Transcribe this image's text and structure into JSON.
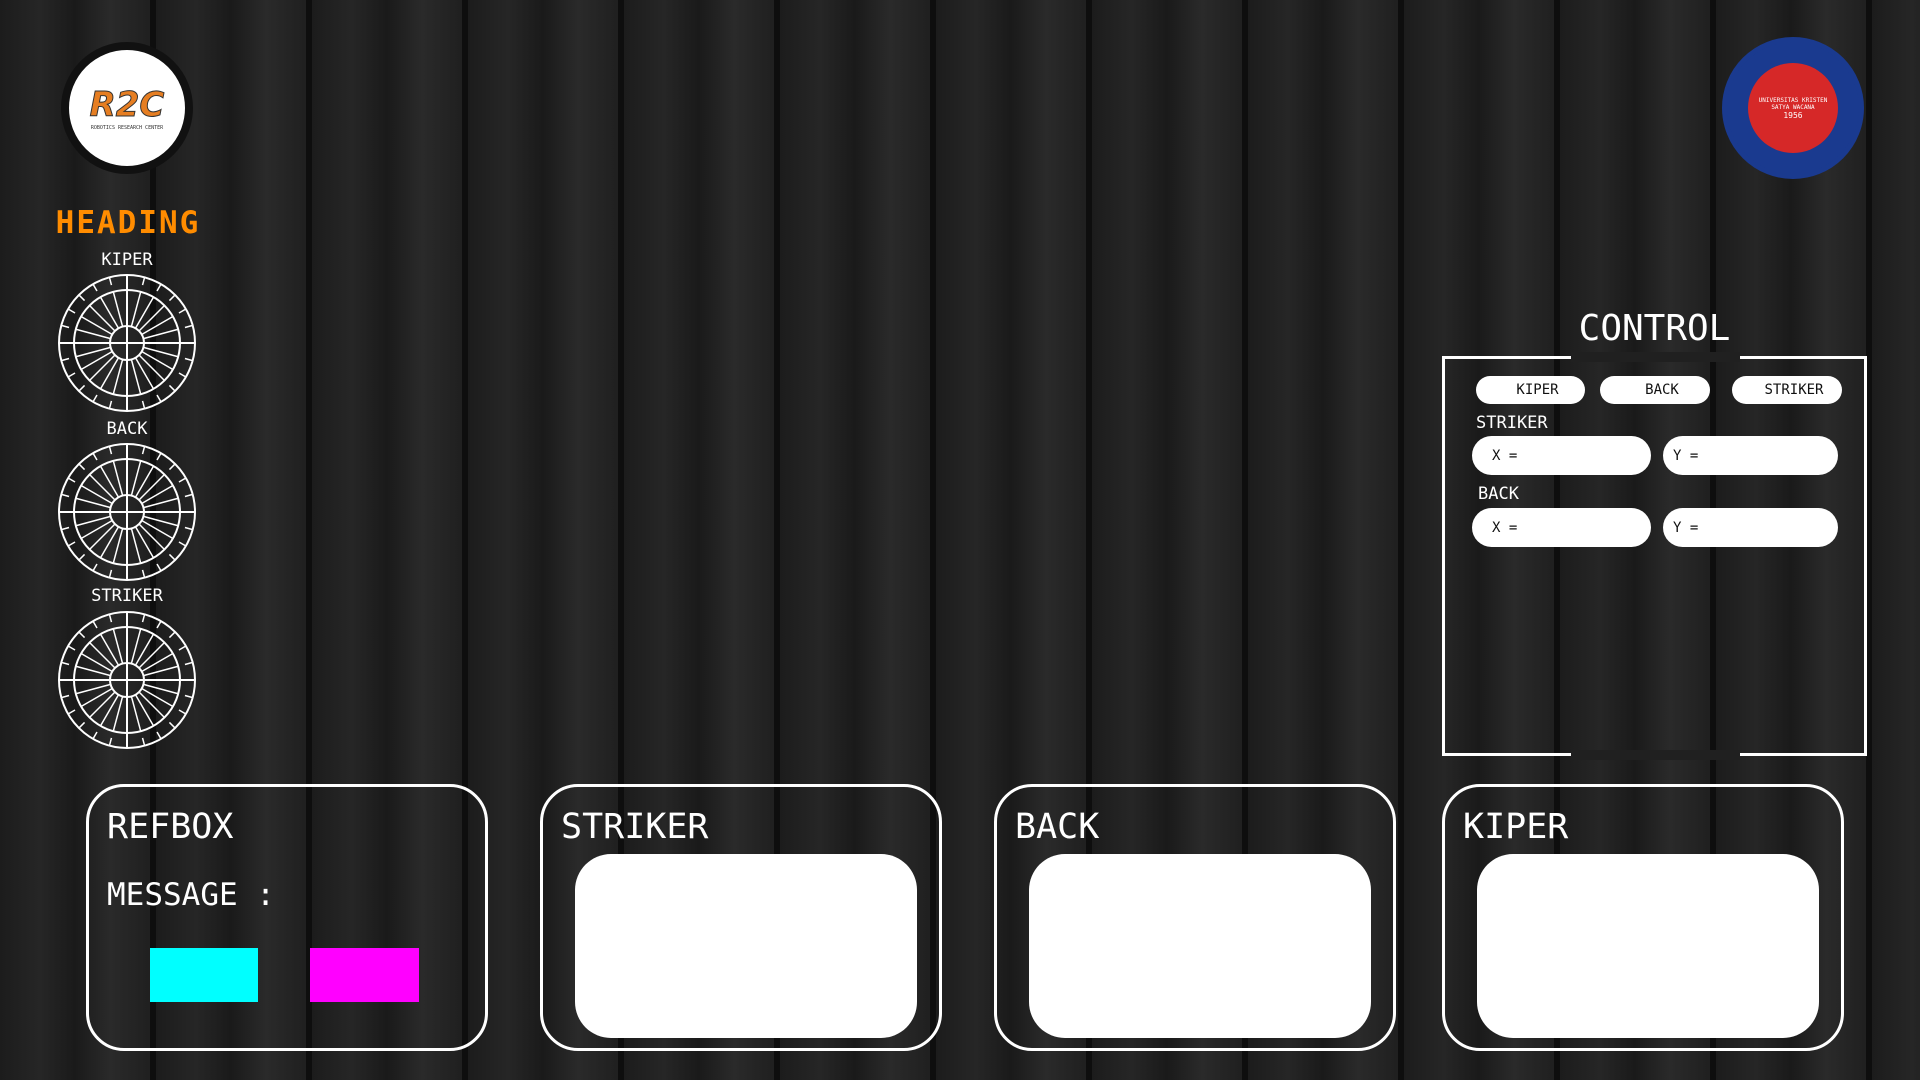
{
  "left_logo": {
    "text": "R2C",
    "subtitle": "ROBOTICS RESEARCH CENTER"
  },
  "right_logo": {
    "text": "UNIVERSITAS KRISTEN SATYA WACANA",
    "year": "1956"
  },
  "heading": {
    "title": "HEADING",
    "dials": [
      {
        "label": "KIPER"
      },
      {
        "label": "BACK"
      },
      {
        "label": "STRIKER"
      }
    ]
  },
  "control": {
    "title": "CONTROL",
    "buttons": [
      "KIPER",
      "BACK",
      "STRIKER"
    ],
    "striker": {
      "label": "STRIKER",
      "x": "X =",
      "y": "Y ="
    },
    "back": {
      "label": "BACK",
      "x": "X =",
      "y": "Y ="
    }
  },
  "panels": {
    "refbox": {
      "title": "REFBOX",
      "message": "MESSAGE :"
    },
    "striker": {
      "title": "STRIKER"
    },
    "back": {
      "title": "BACK"
    },
    "kiper": {
      "title": "KIPER"
    }
  },
  "colors": {
    "accent": "#ff8c00",
    "team_cyan": "#00ffff",
    "team_magenta": "#ff00ff"
  }
}
